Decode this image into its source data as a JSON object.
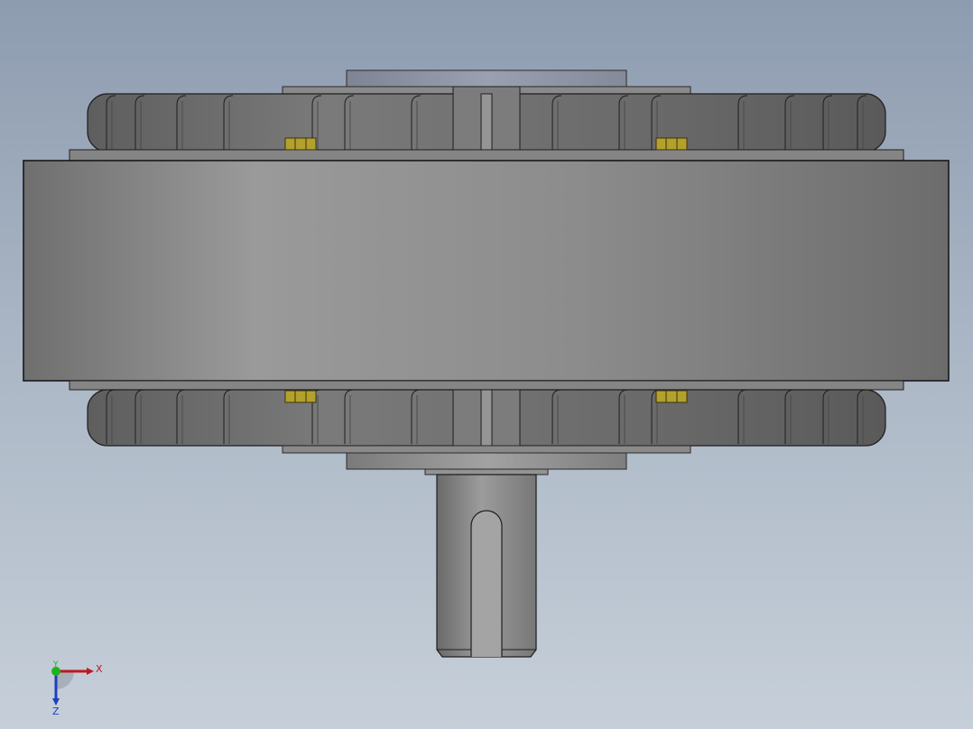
{
  "viewport": {
    "background_top": "#8e9cb0",
    "background_bottom": "#c6cfd9",
    "model_colors": {
      "drum": "#8e8e8e",
      "coil": "#6e6e6e",
      "shaft": "#8a8a8a",
      "nut": "#b3a12c",
      "edge": "#1e1e1e"
    }
  },
  "triad": {
    "x_label": "X",
    "y_label": "Y",
    "z_label": "Z",
    "x_color": "#c0181e",
    "y_color": "#1db31d",
    "z_color": "#1c3fbf"
  }
}
